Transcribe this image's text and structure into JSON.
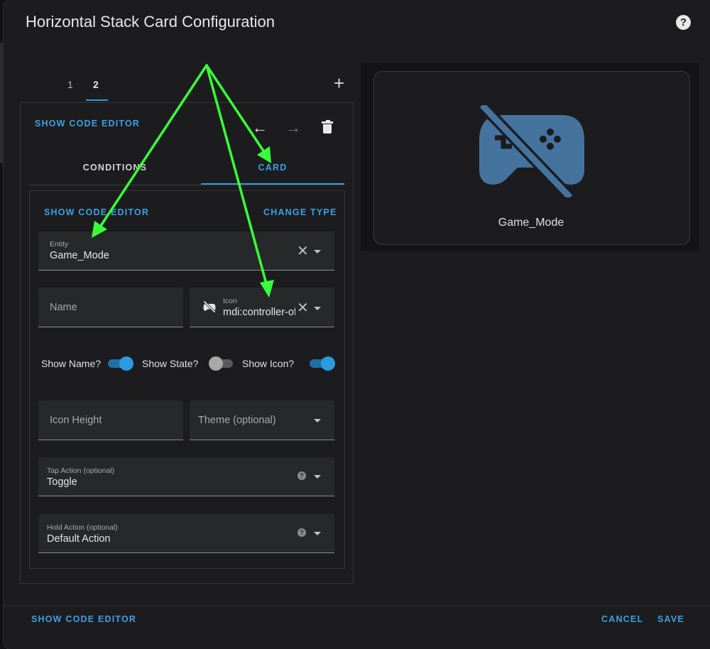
{
  "dialog": {
    "title": "Horizontal Stack Card Configuration",
    "help_icon": "help-circle-icon"
  },
  "stack_tabs": [
    {
      "label": "1",
      "active": false
    },
    {
      "label": "2",
      "active": true
    }
  ],
  "toolbar": {
    "show_code_editor": "SHOW CODE EDITOR",
    "icons": [
      "arrow-left-icon",
      "arrow-right-icon",
      "delete-icon",
      "plus-icon"
    ]
  },
  "condition_tabs": [
    {
      "label": "CONDITIONS",
      "active": false
    },
    {
      "label": "CARD",
      "active": true
    }
  ],
  "card_editor": {
    "show_code_editor": "SHOW CODE EDITOR",
    "change_type": "CHANGE TYPE",
    "entity": {
      "label": "Entity",
      "value": "Game_Mode"
    },
    "name": {
      "placeholder": "Name"
    },
    "icon": {
      "label": "Icon",
      "value": "mdi:controller-off",
      "icon": "controller-off-icon"
    },
    "toggles": [
      {
        "label": "Show Name?",
        "on": true
      },
      {
        "label": "Show State?",
        "on": false
      },
      {
        "label": "Show Icon?",
        "on": true
      }
    ],
    "icon_height": {
      "placeholder": "Icon Height"
    },
    "theme": {
      "placeholder": "Theme (optional)"
    },
    "tap_action": {
      "label": "Tap Action (optional)",
      "value": "Toggle"
    },
    "hold_action": {
      "label": "Hold Action (optional)",
      "value": "Default Action"
    }
  },
  "preview": {
    "name": "Game_Mode",
    "icon": "controller-off-icon",
    "icon_color": "#44739e"
  },
  "footer": {
    "show_code_editor": "SHOW CODE EDITOR",
    "cancel": "CANCEL",
    "save": "SAVE"
  },
  "annotation": {
    "arrow_color": "#39ff39"
  },
  "colors": {
    "accent": "#2d9be0",
    "background": "#1c1c1e"
  }
}
